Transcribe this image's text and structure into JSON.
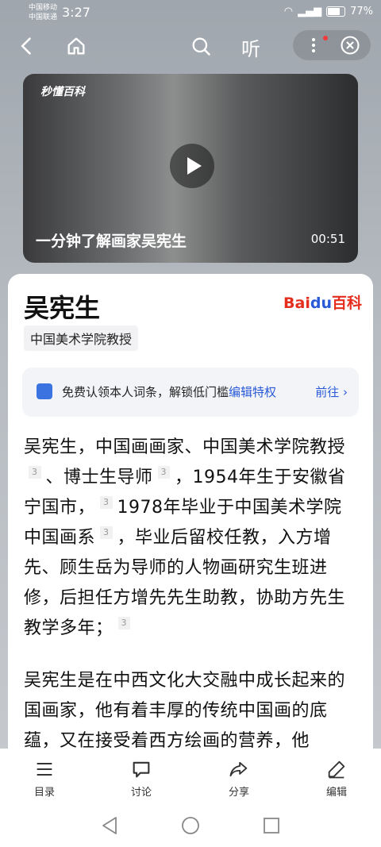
{
  "status": {
    "carrier1": "中国移动",
    "carrier2": "中国联通",
    "time": "3:27",
    "battery": "77%"
  },
  "topbar": {
    "listen_label": "听"
  },
  "video": {
    "logo": "秒懂百科",
    "title": "一分钟了解画家吴宪生",
    "duration": "00:51"
  },
  "entry": {
    "title": "吴宪生",
    "source_logo_a": "Bai",
    "source_logo_b": "du",
    "source_logo_c": "百科",
    "tag": "中国美术学院教授",
    "claim_text": "免费认领本人词条，解锁低门槛",
    "claim_link": "编辑特权",
    "claim_go": "前往 ›",
    "ref_count": "3",
    "p1_a": "吴宪生，中国画画家、中国美术学院教授",
    "p1_b": "、博士生导师",
    "p1_c": "，1954年生于安徽省宁国市，",
    "p1_d": "1978年毕业于中国美术学院中国画系",
    "p1_e": "，毕业后留校任教，入方增先、顾生岳为导师的人物画研究生班进修，后担任方增先先生助教，协助方先生教学多年；",
    "p2": "吴宪生是在中西文化大交融中成长起来的国画家，他有着丰厚的传统中国画的底蕴，又在接受着西方绘画的营养，他"
  },
  "bottom_bar": {
    "toc": "目录",
    "discuss": "讨论",
    "share": "分享",
    "edit": "编辑"
  }
}
